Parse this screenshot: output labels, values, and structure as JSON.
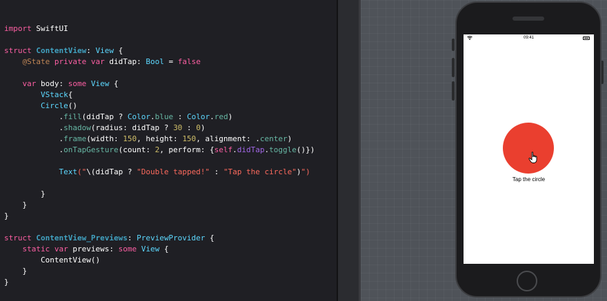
{
  "editor": {
    "lines": [
      [
        {
          "t": "import",
          "c": "kw"
        },
        {
          "t": " SwiftUI",
          "c": "plain"
        }
      ],
      [],
      [
        {
          "t": "struct",
          "c": "kw"
        },
        {
          "t": " ",
          "c": "plain"
        },
        {
          "t": "ContentView",
          "c": "tname bold"
        },
        {
          "t": ": ",
          "c": "plain"
        },
        {
          "t": "View",
          "c": "type"
        },
        {
          "t": " {",
          "c": "plain"
        }
      ],
      [
        {
          "t": "    ",
          "c": "plain"
        },
        {
          "t": "@State",
          "c": "attr"
        },
        {
          "t": " ",
          "c": "plain"
        },
        {
          "t": "private",
          "c": "kw"
        },
        {
          "t": " ",
          "c": "plain"
        },
        {
          "t": "var",
          "c": "kw"
        },
        {
          "t": " didTap: ",
          "c": "plain"
        },
        {
          "t": "Bool",
          "c": "type"
        },
        {
          "t": " = ",
          "c": "plain"
        },
        {
          "t": "false",
          "c": "kw"
        }
      ],
      [],
      [
        {
          "t": "    ",
          "c": "plain"
        },
        {
          "t": "var",
          "c": "kw"
        },
        {
          "t": " body: ",
          "c": "plain"
        },
        {
          "t": "some",
          "c": "kw"
        },
        {
          "t": " ",
          "c": "plain"
        },
        {
          "t": "View",
          "c": "type"
        },
        {
          "t": " {",
          "c": "plain"
        }
      ],
      [
        {
          "t": "        ",
          "c": "plain"
        },
        {
          "t": "VStack",
          "c": "type"
        },
        {
          "t": "{",
          "c": "plain"
        }
      ],
      [
        {
          "t": "        ",
          "c": "plain"
        },
        {
          "t": "Circle",
          "c": "type"
        },
        {
          "t": "()",
          "c": "plain"
        }
      ],
      [
        {
          "t": "            .",
          "c": "plain"
        },
        {
          "t": "fill",
          "c": "fn"
        },
        {
          "t": "(didTap ? ",
          "c": "plain"
        },
        {
          "t": "Color",
          "c": "type"
        },
        {
          "t": ".",
          "c": "plain"
        },
        {
          "t": "blue",
          "c": "fn"
        },
        {
          "t": " : ",
          "c": "plain"
        },
        {
          "t": "Color",
          "c": "type"
        },
        {
          "t": ".",
          "c": "plain"
        },
        {
          "t": "red",
          "c": "fn"
        },
        {
          "t": ")",
          "c": "plain"
        }
      ],
      [
        {
          "t": "            .",
          "c": "plain"
        },
        {
          "t": "shadow",
          "c": "fn"
        },
        {
          "t": "(radius: didTap ? ",
          "c": "plain"
        },
        {
          "t": "30",
          "c": "num"
        },
        {
          "t": " : ",
          "c": "plain"
        },
        {
          "t": "0",
          "c": "num"
        },
        {
          "t": ")",
          "c": "plain"
        }
      ],
      [
        {
          "t": "            .",
          "c": "plain"
        },
        {
          "t": "frame",
          "c": "fn"
        },
        {
          "t": "(width: ",
          "c": "plain"
        },
        {
          "t": "150",
          "c": "num"
        },
        {
          "t": ", height: ",
          "c": "plain"
        },
        {
          "t": "150",
          "c": "num"
        },
        {
          "t": ", alignment: .",
          "c": "plain"
        },
        {
          "t": "center",
          "c": "fn"
        },
        {
          "t": ")",
          "c": "plain"
        }
      ],
      [
        {
          "t": "            .",
          "c": "plain"
        },
        {
          "t": "onTapGesture",
          "c": "fn"
        },
        {
          "t": "(count: ",
          "c": "plain"
        },
        {
          "t": "2",
          "c": "num"
        },
        {
          "t": ", perform: {",
          "c": "plain"
        },
        {
          "t": "self",
          "c": "kw"
        },
        {
          "t": ".",
          "c": "plain"
        },
        {
          "t": "didTap",
          "c": "prop"
        },
        {
          "t": ".",
          "c": "plain"
        },
        {
          "t": "toggle",
          "c": "fn"
        },
        {
          "t": "()})",
          "c": "plain"
        }
      ],
      [],
      [
        {
          "t": "            ",
          "c": "plain"
        },
        {
          "t": "Text",
          "c": "type"
        },
        {
          "t": "(\"",
          "c": "str"
        },
        {
          "t": "\\(didTap ? ",
          "c": "plain"
        },
        {
          "t": "\"Double tapped!\"",
          "c": "str"
        },
        {
          "t": " : ",
          "c": "plain"
        },
        {
          "t": "\"Tap the circle\"",
          "c": "str"
        },
        {
          "t": ")",
          "c": "plain"
        },
        {
          "t": "\")",
          "c": "str"
        }
      ],
      [],
      [
        {
          "t": "        }",
          "c": "plain"
        }
      ],
      [
        {
          "t": "    }",
          "c": "plain"
        }
      ],
      [
        {
          "t": "}",
          "c": "plain"
        }
      ],
      [],
      [
        {
          "t": "struct",
          "c": "kw"
        },
        {
          "t": " ",
          "c": "plain"
        },
        {
          "t": "ContentView_Previews",
          "c": "tname bold"
        },
        {
          "t": ": ",
          "c": "plain"
        },
        {
          "t": "PreviewProvider",
          "c": "type"
        },
        {
          "t": " {",
          "c": "plain"
        }
      ],
      [
        {
          "t": "    ",
          "c": "plain"
        },
        {
          "t": "static",
          "c": "kw"
        },
        {
          "t": " ",
          "c": "plain"
        },
        {
          "t": "var",
          "c": "kw"
        },
        {
          "t": " previews: ",
          "c": "plain"
        },
        {
          "t": "some",
          "c": "kw"
        },
        {
          "t": " ",
          "c": "plain"
        },
        {
          "t": "View",
          "c": "type"
        },
        {
          "t": " {",
          "c": "plain"
        }
      ],
      [
        {
          "t": "        ContentView()",
          "c": "plain"
        }
      ],
      [
        {
          "t": "    }",
          "c": "plain"
        }
      ],
      [
        {
          "t": "}",
          "c": "plain"
        }
      ]
    ],
    "current_line": 13
  },
  "preview": {
    "status_time": "09:41",
    "circle_color": "#ea3f2f",
    "label": "Tap the circle",
    "cursor": "hand-pointer-icon"
  },
  "colors": {
    "keyword": "#fc5fa3",
    "type": "#5dd8ff",
    "string": "#fc6a5d",
    "number": "#d0bf69",
    "function": "#67b7a4"
  }
}
